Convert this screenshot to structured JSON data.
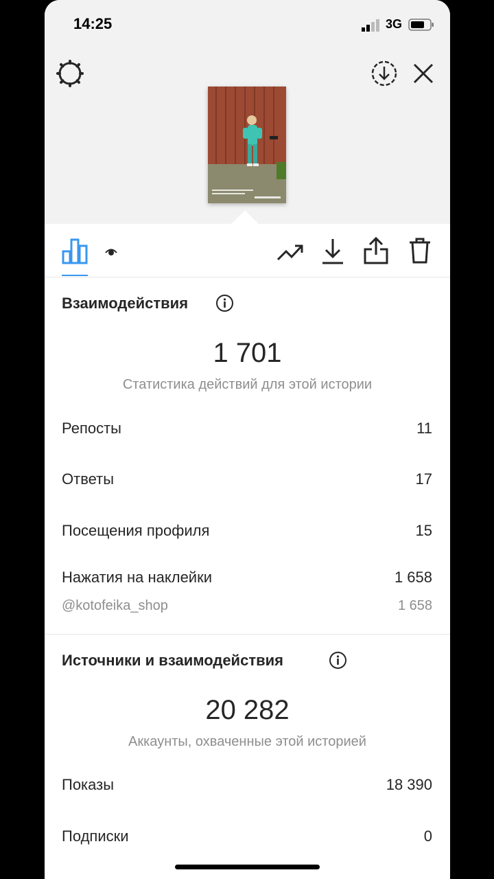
{
  "status": {
    "time": "14:25",
    "network": "3G"
  },
  "interactions": {
    "title": "Взаимодействия",
    "total": "1 701",
    "subtitle": "Статистика действий для этой истории",
    "rows": [
      {
        "label": "Репосты",
        "value": "11"
      },
      {
        "label": "Ответы",
        "value": "17"
      },
      {
        "label": "Посещения профиля",
        "value": "15"
      },
      {
        "label": "Нажатия на наклейки",
        "value": "1 658"
      }
    ],
    "sticker": {
      "label": "@kotofeika_shop",
      "value": "1 658"
    }
  },
  "discovery": {
    "title": "Источники и взаимодействия",
    "total": "20 282",
    "subtitle": "Аккаунты, охваченные этой историей",
    "rows": [
      {
        "label": "Показы",
        "value": "18 390"
      },
      {
        "label": "Подписки",
        "value": "0"
      }
    ]
  },
  "colors": {
    "accent": "#3897f0",
    "text": "#262626",
    "muted": "#8e8e8e"
  },
  "icons": [
    "settings-icon",
    "download-circle-icon",
    "close-icon",
    "insights-icon",
    "viewers-icon",
    "promote-icon",
    "save-icon",
    "share-icon",
    "delete-icon",
    "info-icon"
  ]
}
